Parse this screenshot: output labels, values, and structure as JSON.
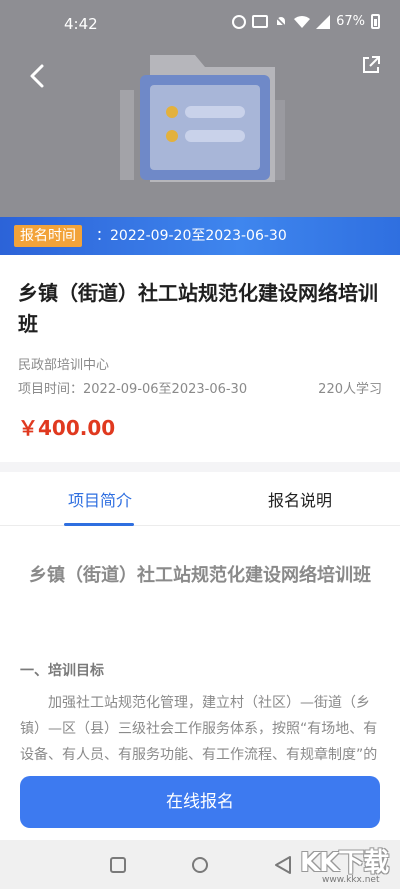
{
  "status_bar": {
    "time": "4:42",
    "battery": "67%"
  },
  "banner": {
    "registration_tag": "报名时间",
    "registration_dates": "：2022-09-20至2023-06-30"
  },
  "course": {
    "title": "乡镇（街道）社工站规范化建设网络培训班",
    "organizer": "民政部培训中心",
    "project_time": "项目时间：2022-09-06至2023-06-30",
    "learners": "220人学习",
    "price": "￥400.00"
  },
  "tabs": [
    {
      "label": "项目简介"
    },
    {
      "label": "报名说明"
    }
  ],
  "content": {
    "title": "乡镇（街道）社工站规范化建设网络培训班",
    "section_heading": "一、培训目标",
    "paragraph": "加强社工站规范化管理，建立村（社区）—街道（乡镇）—区（县）三级社会工作服务体系，按照“有场地、有设备、有人员、有服务功能、有工作流程、有规章制度”的标准，推动社工站有资料、有策略、有"
  },
  "actions": {
    "signup_label": "在线报名"
  },
  "watermark": {
    "logo_text": "KK下载",
    "url": "www.kkx.net"
  },
  "colors": {
    "accent": "#2f6fe0",
    "price": "#e0391f",
    "tag": "#f2a33a",
    "button": "#3d7af0"
  }
}
